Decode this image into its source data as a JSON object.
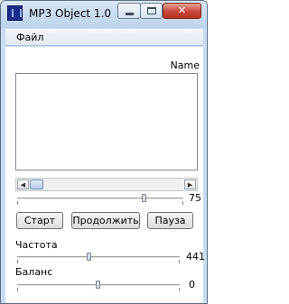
{
  "window": {
    "title": "MP3  Object 1.0",
    "controls": {
      "minimize": "",
      "maximize": "",
      "close": "✕"
    }
  },
  "menu": {
    "file": "Файл"
  },
  "list": {
    "header": "Name",
    "items": []
  },
  "position_slider": {
    "value": "75"
  },
  "buttons": {
    "start": "Старт",
    "continue": "Продолжить",
    "pause": "Пауза"
  },
  "frequency": {
    "label": "Частота",
    "value": "441"
  },
  "balance": {
    "label": "Баланс",
    "value": "0"
  },
  "colors": {
    "window_frame": "#c9dcf0",
    "close_button": "#c7493a",
    "scroll_thumb": "#b7cde8"
  }
}
